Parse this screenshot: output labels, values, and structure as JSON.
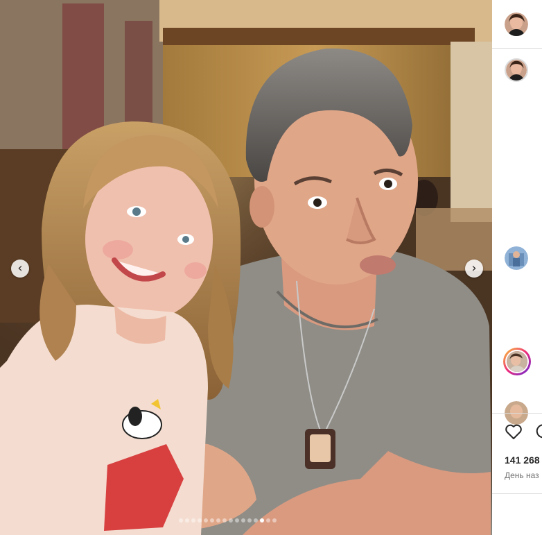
{
  "post": {
    "photo_description_icon": "photo",
    "carousel": {
      "prev_arrow": "‹",
      "next_arrow": "›",
      "total_slides": 16,
      "active_slide": 14
    }
  },
  "panel": {
    "likes": "141 268",
    "time_ago": "День наз",
    "icons": {
      "like": "heart-icon",
      "comment": "comment-icon"
    }
  }
}
